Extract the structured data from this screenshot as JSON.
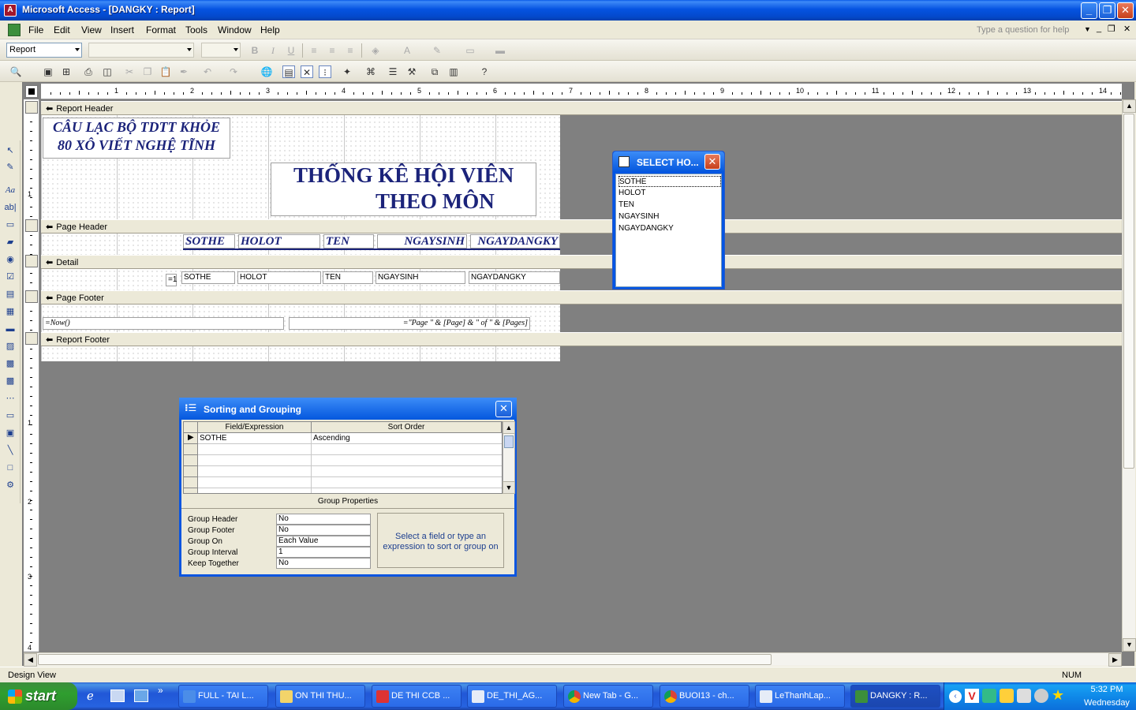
{
  "window": {
    "title": "Microsoft Access - [DANGKY : Report]",
    "minimize": "_",
    "restore": "❐",
    "close": "✕"
  },
  "menu": {
    "items": [
      "File",
      "Edit",
      "View",
      "Insert",
      "Format",
      "Tools",
      "Window",
      "Help"
    ],
    "help_placeholder": "Type a question for help"
  },
  "toolbar": {
    "object_combo": "Report"
  },
  "report": {
    "sections": {
      "report_header": "Report Header",
      "page_header": "Page Header",
      "detail": "Detail",
      "page_footer": "Page Footer",
      "report_footer": "Report Footer"
    },
    "header_label_line1": "CÂU LẠC BỘ TDTT KHỎE",
    "header_label_line2": "80 XÔ VIẾT NGHỆ TĨNH",
    "title_line1": "THỐNG KÊ HỘI VIÊN",
    "title_line2": "THEO MÔN",
    "page_header_labels": [
      "SOTHE",
      "HOLOT",
      "TEN",
      "NGAYSINH",
      "NGAYDANGKY"
    ],
    "detail_counter": "=1",
    "detail_fields": [
      "SOTHE",
      "HOLOT",
      "TEN",
      "NGAYSINH",
      "NGAYDANGKY"
    ],
    "footer_now": "=Now()",
    "footer_pages": "=\"Page \" & [Page] & \" of \" & [Pages]",
    "ruler_numbers": [
      "1",
      "2",
      "3",
      "4",
      "5",
      "6",
      "7",
      "8",
      "9",
      "10",
      "11",
      "12",
      "13",
      "14"
    ],
    "vruler_numbers": [
      "1",
      "1",
      "2",
      "3",
      "4"
    ]
  },
  "field_list": {
    "title": "SELECT HO...",
    "items": [
      "SOTHE",
      "HOLOT",
      "TEN",
      "NGAYSINH",
      "NGAYDANGKY"
    ]
  },
  "sorting": {
    "title": "Sorting and Grouping",
    "col_field": "Field/Expression",
    "col_order": "Sort Order",
    "rows": [
      {
        "field": "SOTHE",
        "order": "Ascending"
      }
    ],
    "group_properties": "Group Properties",
    "props": [
      {
        "label": "Group Header",
        "value": "No"
      },
      {
        "label": "Group Footer",
        "value": "No"
      },
      {
        "label": "Group On",
        "value": "Each Value"
      },
      {
        "label": "Group Interval",
        "value": "1"
      },
      {
        "label": "Keep Together",
        "value": "No"
      }
    ],
    "hint": "Select a field or type an expression to sort or group on"
  },
  "status": {
    "left": "Design View",
    "num": "NUM"
  },
  "taskbar": {
    "start": "start",
    "buttons": [
      "FULL - TAI L...",
      "ON THI THU...",
      "DE THI CCB ...",
      "DE_THI_AG...",
      "New Tab - G...",
      "BUOI13 - ch...",
      "LeThanhLap...",
      "DANGKY : R..."
    ],
    "time": "5:32 PM",
    "day": "Wednesday"
  }
}
